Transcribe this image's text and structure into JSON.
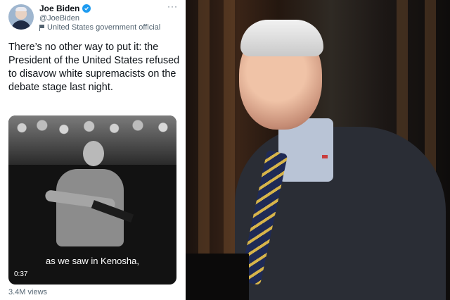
{
  "tweet": {
    "name": "Joe Biden",
    "handle": "@JoeBiden",
    "label": "United States government official",
    "text": "There’s no other way to put it: the President of the United States refused to disavow white supremacists on the debate stage last night.",
    "more": "···",
    "video": {
      "caption": "as we saw in Kenosha,",
      "timecode": "0:37"
    },
    "views": "3.4M views"
  },
  "colors": {
    "verified": "#1d9bf0",
    "secondary_text": "#536471",
    "primary_text": "#0f1419"
  },
  "icons": [
    "verified-badge-icon",
    "flag-icon",
    "more-icon"
  ]
}
